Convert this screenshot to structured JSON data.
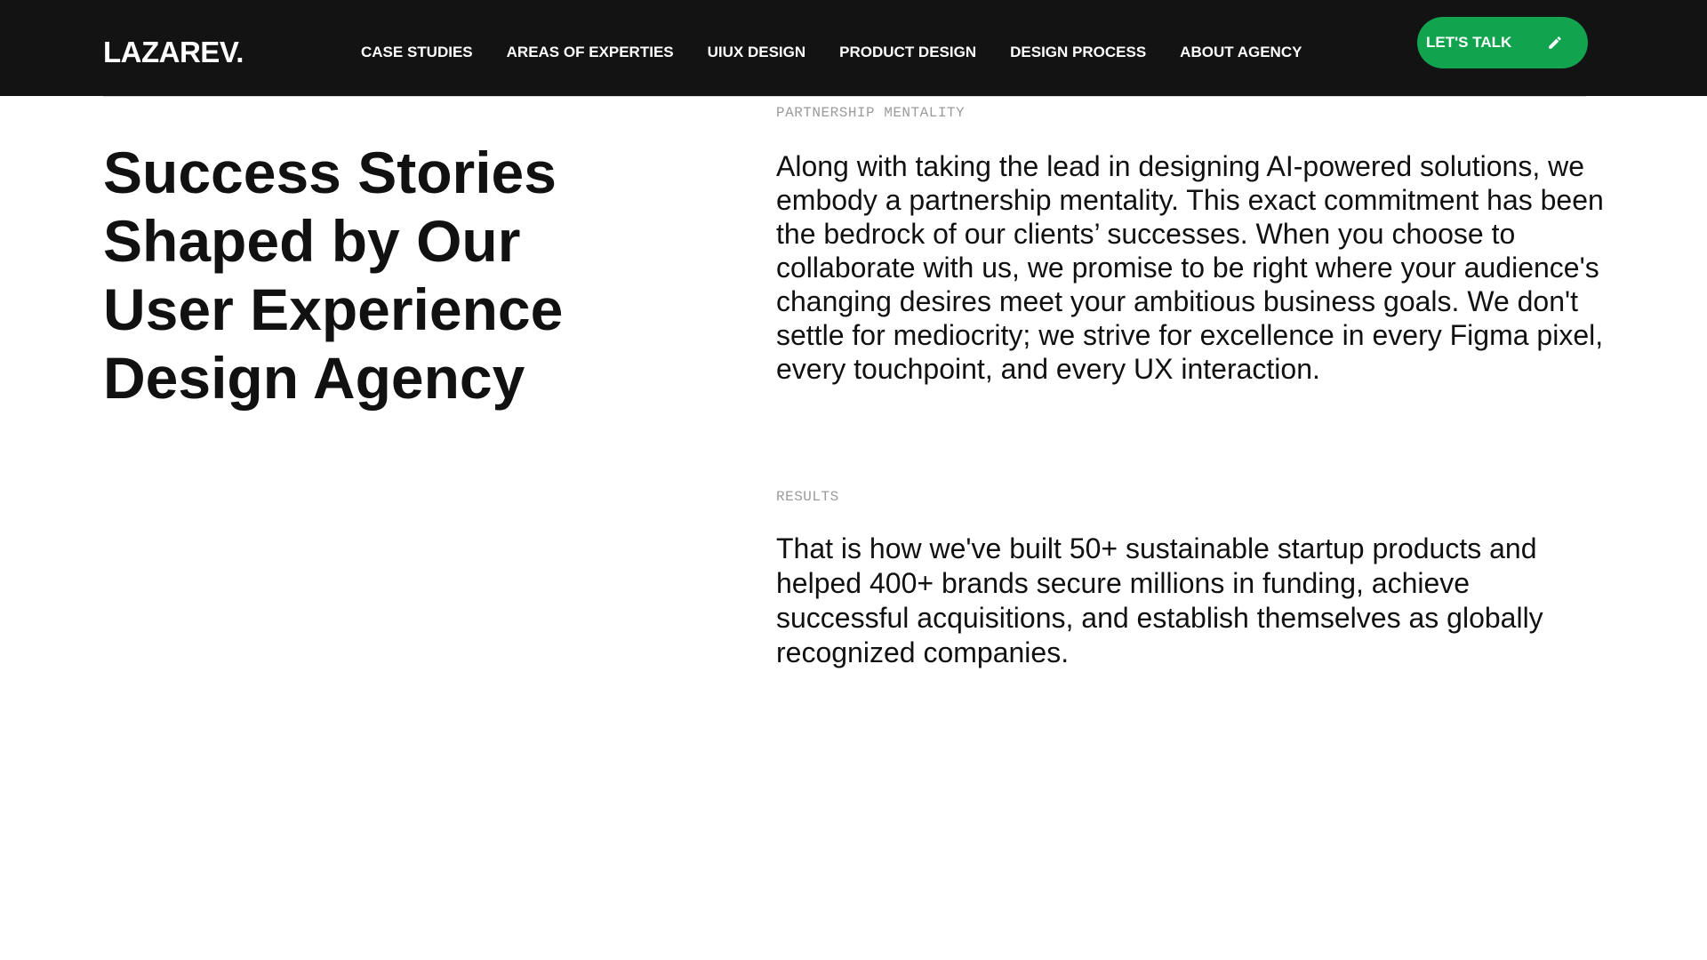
{
  "brand": {
    "logo": "LAZAREV."
  },
  "nav": {
    "items": [
      "CASE STUDIES",
      "AREAS OF EXPERTIES",
      "UIUX DESIGN",
      "PRODUCT DESIGN",
      "DESIGN PROCESS",
      "ABOUT AGENCY"
    ]
  },
  "cta": {
    "label": "LET'S TALK",
    "icon": "pencil-icon",
    "color": "#12a34e"
  },
  "colors": {
    "topbar": "#131313",
    "accent": "#12a34e",
    "text": "#111111",
    "muted": "#9b9b9b"
  },
  "main": {
    "heading": "Success Stories Shaped by Our User Experience Design Agency",
    "sections": [
      {
        "eyebrow": "PARTNERSHIP MENTALITY",
        "text": "Along with taking the lead in designing AI-powered solutions, we embody a partnership mentality. This exact commitment has been the bedrock of our clients’ successes. When you choose to collaborate with us, we promise to be right where your audience's changing desires meet your ambitious business goals. We don't settle for mediocrity; we strive for excellence in every Figma pixel, every touchpoint, and every UX interaction."
      },
      {
        "eyebrow": "RESULTS",
        "text": "That is how we've built 50+ sustainable startup products and helped 400+ brands secure millions in funding, achieve successful acquisitions, and establish themselves as globally recognized companies."
      }
    ]
  }
}
